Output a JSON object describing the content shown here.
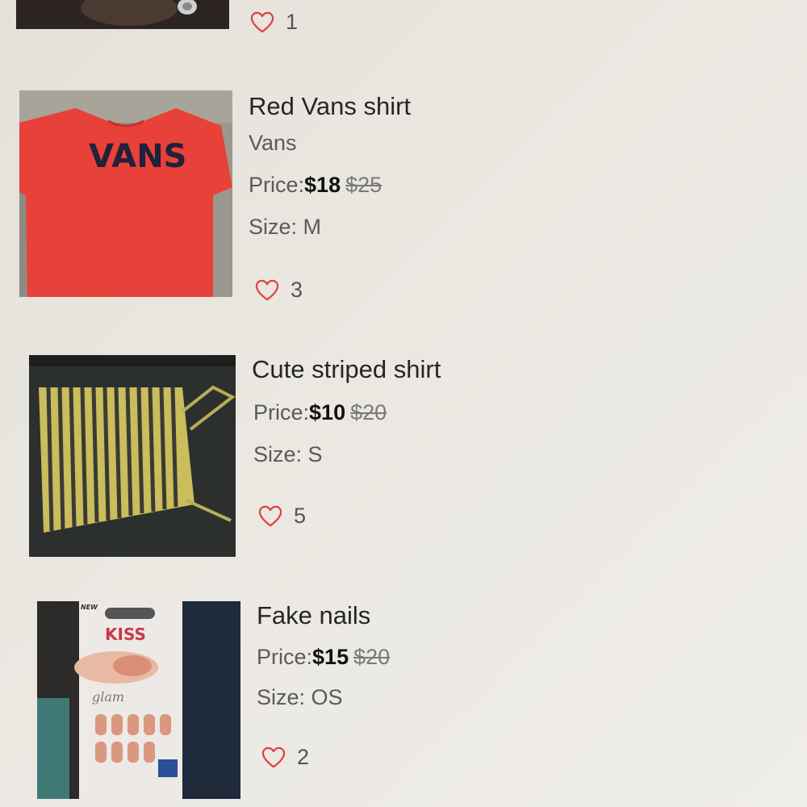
{
  "colors": {
    "heart": "#e0413f",
    "background": "#e9e6e0"
  },
  "items": [
    {
      "likes": "1",
      "thumbnail": "partial-photo"
    },
    {
      "title": "Red Vans shirt",
      "brand": "Vans",
      "price_label": "Price:",
      "price": "$18",
      "original_price": "$25",
      "size": "Size: M",
      "likes": "3",
      "thumbnail": "red-vans-tshirt-photo"
    },
    {
      "title": "Cute striped shirt",
      "price_label": "Price:",
      "price": "$10",
      "original_price": "$20",
      "size": "Size: S",
      "likes": "5",
      "thumbnail": "striped-tank-top-photo"
    },
    {
      "title": "Fake nails",
      "price_label": "Price:",
      "price": "$15",
      "original_price": "$20",
      "size": "Size: OS",
      "likes": "2",
      "thumbnail": "kiss-fake-nails-package-photo"
    }
  ],
  "thumb_texts": {
    "vans_logo": "VANS",
    "kiss_logo": "KISS",
    "kiss_new": "NEW",
    "kiss_line": "glam"
  }
}
